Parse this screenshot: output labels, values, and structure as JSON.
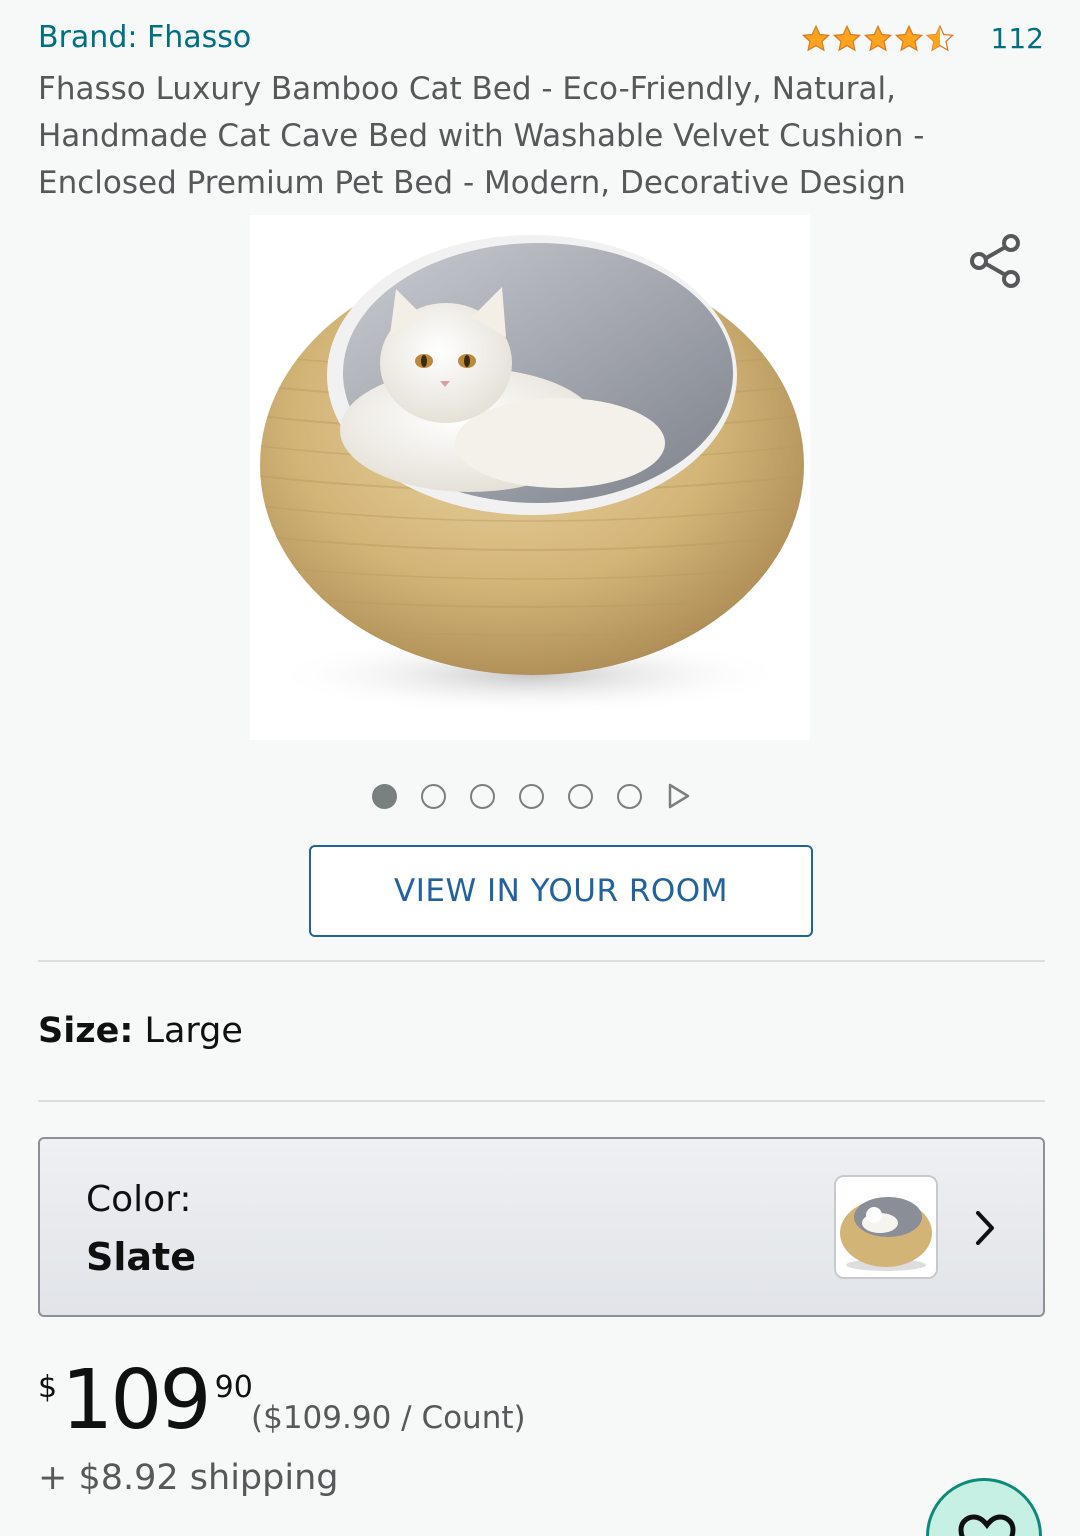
{
  "product": {
    "brand": "Brand: Fhasso",
    "rating": 4.5,
    "rating_count": "112",
    "title": "Fhasso Luxury Bamboo Cat Bed - Eco-Friendly, Natural, Handmade Cat Cave Bed with Washable Velvet Cushion - Enclosed Premium Pet Bed - Modern, Decorative Design"
  },
  "gallery": {
    "image_count": 6,
    "active_index": 0,
    "view_in_room_label": "VIEW IN YOUR ROOM"
  },
  "size": {
    "label": "Size:",
    "value": "Large"
  },
  "color": {
    "label": "Color:",
    "value": "Slate"
  },
  "price": {
    "symbol": "$",
    "whole": "109",
    "fraction": "90",
    "unit_price": "($109.90 / Count)",
    "shipping": "+ $8.92 shipping"
  },
  "icons": {
    "share": "share-icon",
    "next_image": "play-icon",
    "chevron": "chevron-right-icon",
    "fab": "heart-icon"
  },
  "colors": {
    "link": "#007185",
    "star": "#ffa41c",
    "button_border": "#2162a1",
    "fab_border": "#0d8b78"
  }
}
